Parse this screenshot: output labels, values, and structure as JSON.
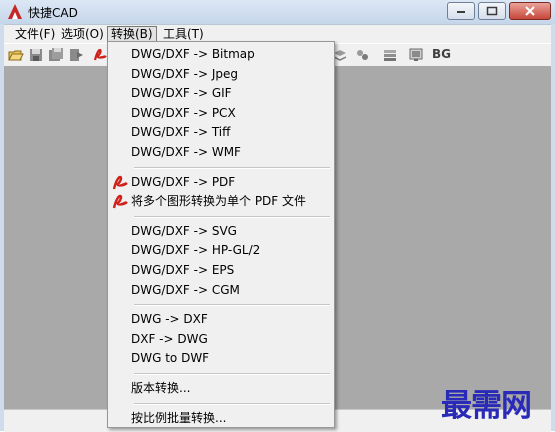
{
  "window": {
    "title": "快捷CAD"
  },
  "menubar": [
    {
      "label": "文件(F)",
      "active": false
    },
    {
      "label": "选项(O)",
      "active": false
    },
    {
      "label": "转换(B)",
      "active": true
    },
    {
      "label": "工具(T)",
      "active": false
    }
  ],
  "toolbar": {
    "bg_label": "BG"
  },
  "dropdown": {
    "groups": [
      [
        {
          "label": "DWG/DXF -> Bitmap"
        },
        {
          "label": "DWG/DXF -> Jpeg"
        },
        {
          "label": "DWG/DXF -> GIF"
        },
        {
          "label": "DWG/DXF -> PCX"
        },
        {
          "label": "DWG/DXF -> Tiff"
        },
        {
          "label": "DWG/DXF -> WMF"
        }
      ],
      [
        {
          "label": "DWG/DXF -> PDF",
          "icon": "pdf-icon"
        },
        {
          "label": "将多个图形转换为单个 PDF 文件",
          "icon": "pdf-icon"
        }
      ],
      [
        {
          "label": "DWG/DXF -> SVG"
        },
        {
          "label": "DWG/DXF -> HP-GL/2"
        },
        {
          "label": "DWG/DXF -> EPS"
        },
        {
          "label": "DWG/DXF -> CGM"
        }
      ],
      [
        {
          "label": "DWG -> DXF"
        },
        {
          "label": "DXF -> DWG"
        },
        {
          "label": "DWG to DWF"
        }
      ],
      [
        {
          "label": "版本转换..."
        }
      ],
      [
        {
          "label": "按比例批量转换..."
        }
      ]
    ]
  },
  "watermark": "最需网",
  "colors": {
    "workspace": "#a9a9a9",
    "menu_bg": "#f0f0f0",
    "watermark": "#2a2ab8"
  }
}
